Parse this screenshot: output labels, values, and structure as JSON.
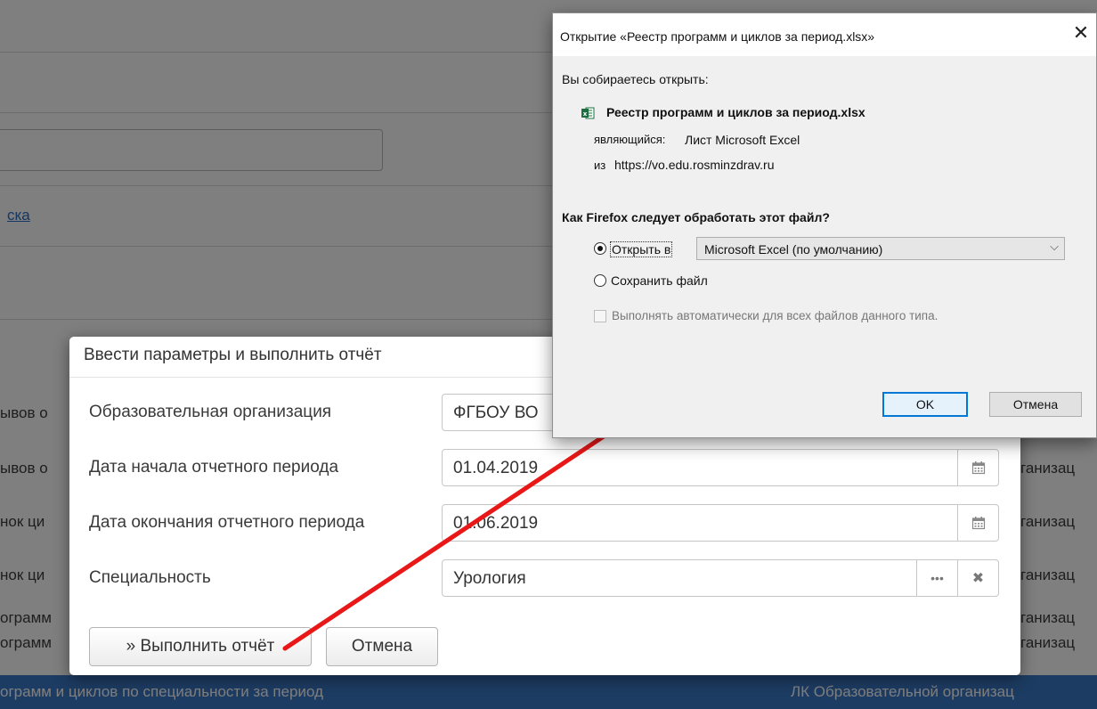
{
  "background": {
    "link_text": "ска",
    "rows_left": [
      "ывов о",
      "ывов о",
      "нок ци",
      "нок ци",
      "ограмм",
      "ограмм"
    ],
    "rows_right": [
      "ганизац",
      "ганизац",
      "ганизац",
      "ганизац",
      "ганизац"
    ],
    "selected_row_left": "ограмм и циклов по специальности за период",
    "selected_row_right": "ЛК Образовательной организац",
    "selected_color": "#3b78c6"
  },
  "report_dialog": {
    "title": "Ввести параметры и выполнить отчёт",
    "fields": [
      {
        "label": "Образовательная организация",
        "value": "ФГБОУ ВО"
      },
      {
        "label": "Дата начала отчетного периода",
        "value": "01.04.2019",
        "icon": "calendar-icon"
      },
      {
        "label": "Дата окончания отчетного периода",
        "value": "01.06.2019",
        "icon": "calendar-icon"
      },
      {
        "label": "Специальность",
        "value": "Урология",
        "icons": [
          "ellipsis-icon",
          "clear-icon"
        ]
      }
    ],
    "run_button": "» Выполнить отчёт",
    "cancel_button": "Отмена"
  },
  "firefox_dialog": {
    "title": "Открытие «Реестр программ и циклов за период.xlsx»",
    "close_symbol": "✕",
    "intro": "Вы собираетесь открыть:",
    "file_name": "Реестр программ и циклов за период.xlsx",
    "file_icon": "excel-icon",
    "type_label": "являющийся:",
    "type_value": "Лист Microsoft Excel",
    "from_label": "из",
    "from_value": "https://vo.edu.rosminzdrav.ru",
    "question": "Как Firefox следует обработать этот файл?",
    "open_with_label": "Открыть в",
    "open_with_value": "Microsoft Excel (по умолчанию)",
    "save_label": "Сохранить файл",
    "auto_label": "Выполнять автоматически для всех файлов данного типа.",
    "ok_button": "OK",
    "cancel_button": "Отмена",
    "accent_color": "#0078d7"
  },
  "annotation": {
    "arrow_color": "#e81818"
  }
}
